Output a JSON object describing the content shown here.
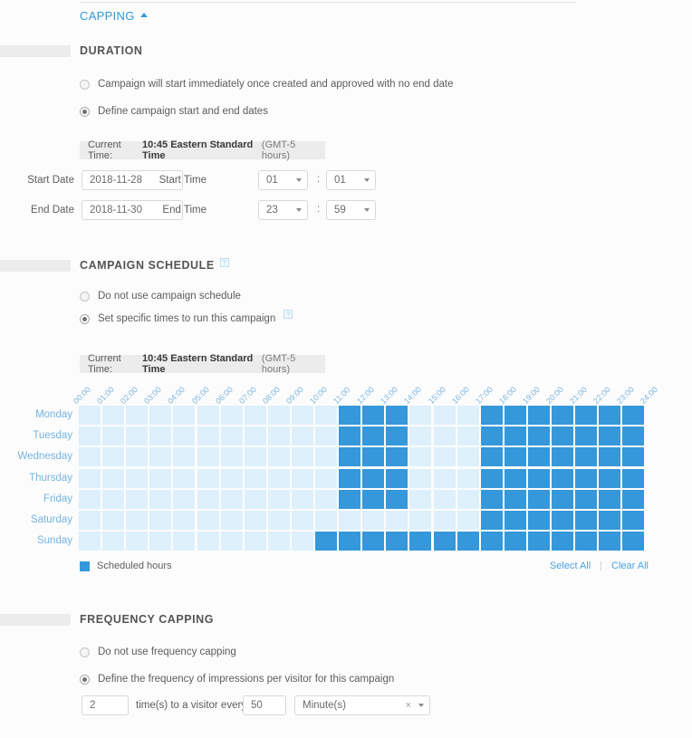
{
  "header": {
    "capping_label": "CAPPING",
    "collapse_icon": "caret-up-icon"
  },
  "duration": {
    "title": "DURATION",
    "options": [
      {
        "label": "Campaign will start immediately once created and approved with no end date",
        "selected": false
      },
      {
        "label": "Define campaign start and end dates",
        "selected": true
      }
    ],
    "current_time": {
      "prefix": "Current Time:",
      "time_zone": "10:45 Eastern Standard Time",
      "offset": "(GMT-5 hours)"
    },
    "start_date_label": "Start Date",
    "start_date_value": "2018-11-28",
    "end_date_label": "End Date",
    "end_date_value": "2018-11-30",
    "start_time_label": "Start Time",
    "start_time_hour": "01",
    "start_time_minute": "01",
    "end_time_label": "End Time",
    "end_time_hour": "23",
    "end_time_minute": "59",
    "time_separator": ":"
  },
  "schedule": {
    "title": "CAMPAIGN SCHEDULE",
    "title_help": "?",
    "options": [
      {
        "label": "Do not use campaign schedule",
        "selected": false,
        "help": ""
      },
      {
        "label": "Set specific times to run this campaign",
        "selected": true,
        "help": "?"
      }
    ],
    "current_time": {
      "prefix": "Current Time:",
      "time_zone": "10:45 Eastern Standard Time",
      "offset": "(GMT-5 hours)"
    },
    "hour_labels": [
      "00:00",
      "01:00",
      "02:00",
      "03:00",
      "04:00",
      "05:00",
      "06:00",
      "07:00",
      "08:00",
      "09:00",
      "10:00",
      "11:00",
      "12:00",
      "13:00",
      "14:00",
      "15:00",
      "16:00",
      "17:00",
      "18:00",
      "19:00",
      "20:00",
      "21:00",
      "22:00",
      "23:00",
      "24:00"
    ],
    "days": [
      "Monday",
      "Tuesday",
      "Wednesday",
      "Thursday",
      "Friday",
      "Saturday",
      "Sunday"
    ],
    "selected_hours": [
      [
        11,
        12,
        13,
        17,
        18,
        19,
        20,
        21,
        22,
        23
      ],
      [
        11,
        12,
        13,
        17,
        18,
        19,
        20,
        21,
        22,
        23
      ],
      [
        11,
        12,
        13,
        17,
        18,
        19,
        20,
        21,
        22,
        23
      ],
      [
        11,
        12,
        13,
        17,
        18,
        19,
        20,
        21,
        22,
        23
      ],
      [
        11,
        12,
        13,
        17,
        18,
        19,
        20,
        21,
        22,
        23
      ],
      [
        17,
        18,
        19,
        20,
        21,
        22,
        23
      ],
      [
        10,
        11,
        12,
        13,
        14,
        15,
        16,
        17,
        18,
        19,
        20,
        21,
        22,
        23
      ]
    ],
    "legend_label": "Scheduled hours",
    "select_all_label": "Select All",
    "clear_all_label": "Clear All",
    "separator": "|",
    "colors": {
      "selected": "#3498db",
      "empty": "#ddf0fb",
      "label": "#74b4e0"
    }
  },
  "frequency": {
    "title": "FREQUENCY CAPPING",
    "options": [
      {
        "label": "Do not use frequency capping",
        "selected": false
      },
      {
        "label": "Define the frequency of impressions per visitor for this campaign",
        "selected": true
      }
    ],
    "times_value": "2",
    "middle_label": "time(s) to a visitor every",
    "every_value": "50",
    "unit_value": "Minute(s)",
    "clear_icon": "×"
  }
}
